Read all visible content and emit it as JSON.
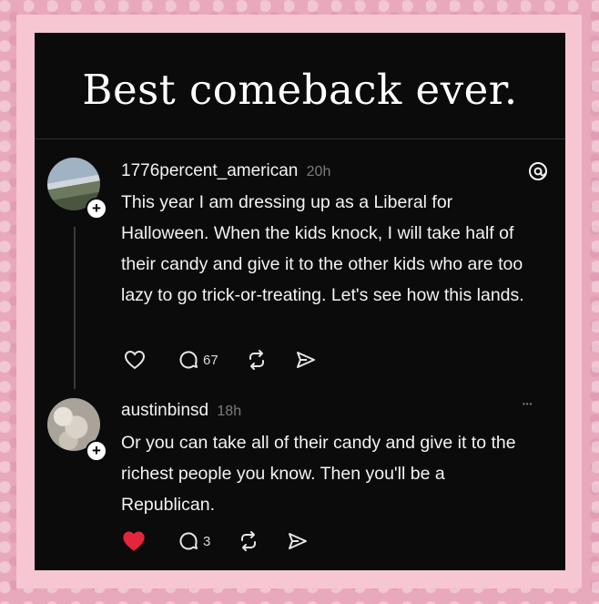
{
  "headline": "Best comeback ever.",
  "posts": [
    {
      "username": "1776percent_american",
      "time": "20h",
      "text": "This year I am dressing up as a Liberal for Halloween. When the kids knock, I will take half of their candy and give it to the other kids who are too lazy to go trick-or-treating. Let's see how this lands.",
      "replies": "67",
      "liked": false,
      "icons": [
        "heart-icon",
        "comment-icon",
        "repost-icon",
        "share-icon",
        "threads-logo-icon"
      ]
    },
    {
      "username": "austinbinsd",
      "time": "18h",
      "text": "Or you can take all of their candy and give it to the richest people you know. Then you'll be a Republican.",
      "replies": "3",
      "liked": true,
      "more": "•••",
      "icons": [
        "heart-filled-icon",
        "comment-icon",
        "repost-icon",
        "share-icon",
        "more-icon"
      ]
    }
  ],
  "colors": {
    "background": "#e9a9bd",
    "frame": "#f6c6d3",
    "panel": "#0b0b0c",
    "text": "#f3f3f3",
    "muted": "#7c7c80",
    "like": "#e3263c"
  }
}
